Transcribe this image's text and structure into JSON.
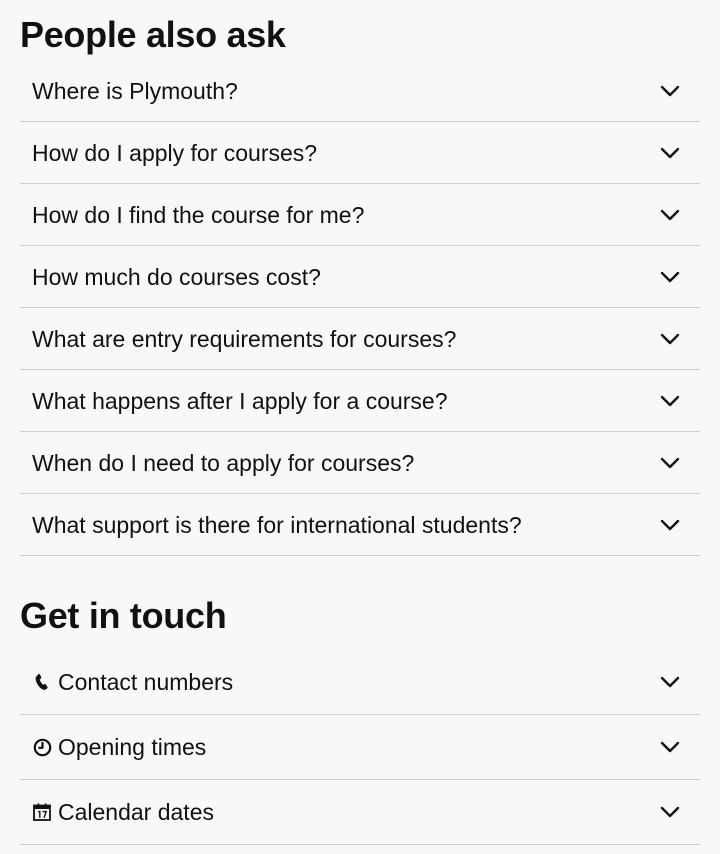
{
  "faq": {
    "title": "People also ask",
    "items": [
      {
        "question": "Where is Plymouth?"
      },
      {
        "question": "How do I apply for courses?"
      },
      {
        "question": "How do I find the course for me?"
      },
      {
        "question": "How much do courses cost?"
      },
      {
        "question": "What are entry requirements for courses?"
      },
      {
        "question": "What happens after I apply for a course?"
      },
      {
        "question": "When do I need to apply for courses?"
      },
      {
        "question": "What support is there for international students?"
      }
    ]
  },
  "contact": {
    "title": "Get in touch",
    "items": [
      {
        "label": "Contact numbers",
        "icon": "phone-icon"
      },
      {
        "label": "Opening times",
        "icon": "clock-icon"
      },
      {
        "label": "Calendar dates",
        "icon": "calendar-icon"
      }
    ]
  },
  "colors": {
    "background": "#f8f8f8",
    "text": "#111111",
    "divider": "#cfcfcf"
  }
}
